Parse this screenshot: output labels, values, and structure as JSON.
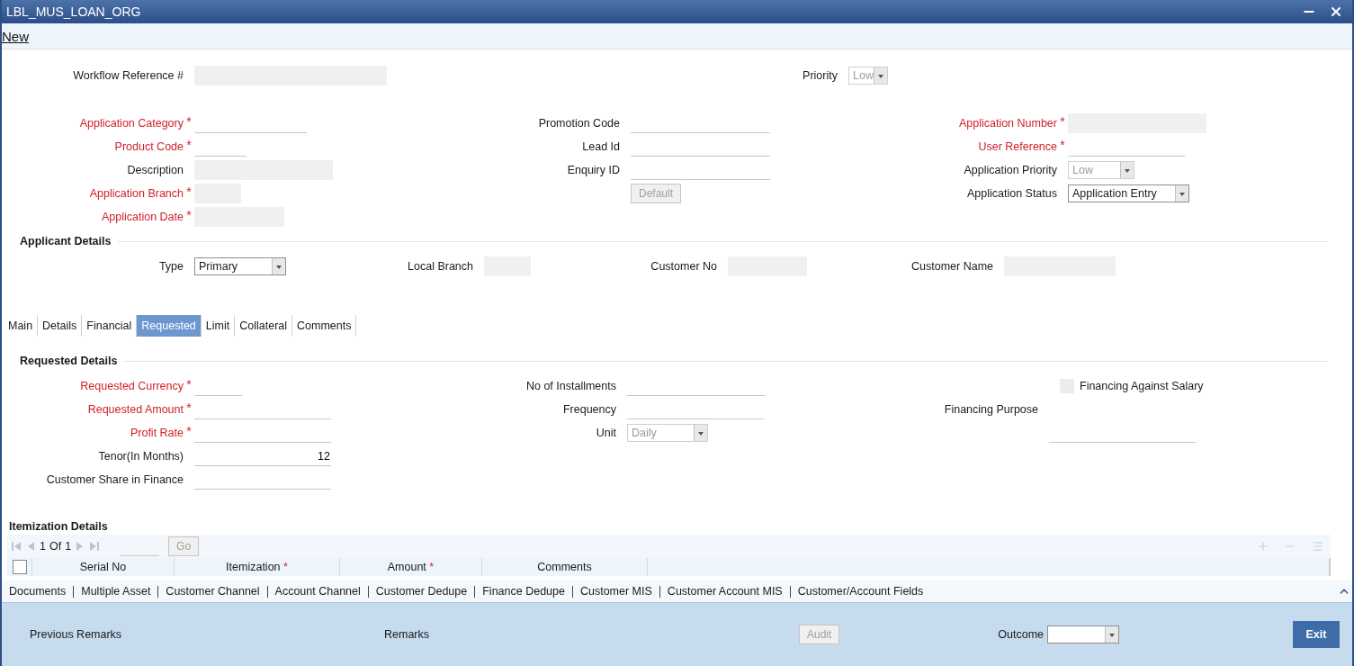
{
  "window": {
    "title": "LBL_MUS_LOAN_ORG"
  },
  "toolbar": {
    "link": "New"
  },
  "top_fields": [
    {
      "label": "Workflow Reference #",
      "kind": "text",
      "disabled": true
    },
    {
      "label": "Priority",
      "kind": "select",
      "value": "Low",
      "disabled": true
    }
  ],
  "header": {
    "columns": [
      [
        {
          "label": "Application Category",
          "required_mark": "*",
          "kind": "text",
          "disabled": false
        },
        {
          "label": "Product Code",
          "required_mark": "*",
          "kind": "text",
          "disabled": false
        },
        {
          "label": "Description",
          "kind": "text",
          "disabled": true
        },
        {
          "label": "Application Branch",
          "required_mark": "*",
          "kind": "text",
          "disabled": true
        },
        {
          "label": "Application Date",
          "required_mark": "*",
          "kind": "text",
          "disabled": true
        }
      ],
      [
        {
          "label": "Promotion Code",
          "kind": "text",
          "disabled": false
        },
        {
          "label": "Lead Id",
          "kind": "text",
          "disabled": false
        },
        {
          "label": "Enquiry ID",
          "kind": "text",
          "disabled": false
        },
        {
          "label": "Default",
          "kind": "button",
          "disabled": true
        }
      ],
      [
        {
          "label": "Application Number",
          "required_mark": "*",
          "kind": "text",
          "disabled": true
        },
        {
          "label": "User Reference",
          "required_mark": "*",
          "kind": "text",
          "disabled": false
        },
        {
          "label": "Application Priority",
          "kind": "select",
          "value": "Low",
          "disabled": true
        },
        {
          "label": "Application Status",
          "kind": "select",
          "value": "Application Entry",
          "disabled": false
        }
      ]
    ]
  },
  "applicant": {
    "title": "Applicant Details",
    "fields": [
      {
        "label": "Type",
        "kind": "select",
        "value": "Primary",
        "disabled": false
      },
      {
        "label": "Local Branch",
        "kind": "text",
        "disabled": true
      },
      {
        "label": "Customer No",
        "kind": "text",
        "disabled": true
      },
      {
        "label": "Customer Name",
        "kind": "text",
        "disabled": true
      }
    ]
  },
  "tabs": [
    {
      "label": "Main",
      "selected": false
    },
    {
      "label": "Details",
      "selected": false
    },
    {
      "label": "Financial",
      "selected": false
    },
    {
      "label": "Requested",
      "selected": true
    },
    {
      "label": "Limit",
      "selected": false
    },
    {
      "label": "Collateral",
      "selected": false
    },
    {
      "label": "Comments",
      "selected": false
    }
  ],
  "requested": {
    "title": "Requested Details",
    "columns": [
      [
        {
          "label": "Requested Currency",
          "required_mark": "*",
          "kind": "text",
          "disabled": false
        },
        {
          "label": "Requested Amount",
          "required_mark": "*",
          "kind": "text",
          "disabled": false
        },
        {
          "label": "Profit Rate",
          "required_mark": "*",
          "kind": "text",
          "disabled": false
        },
        {
          "label": "Tenor(In Months)",
          "kind": "number",
          "value": "12",
          "disabled": false
        },
        {
          "label": "Customer Share in Finance",
          "kind": "text",
          "disabled": false
        }
      ],
      [
        {
          "label": "No of Installments",
          "kind": "text",
          "disabled": false
        },
        {
          "label": "Frequency",
          "kind": "text",
          "disabled": false
        },
        {
          "label": "Unit",
          "kind": "select",
          "value": "Daily",
          "disabled": true
        }
      ],
      [
        {
          "label": "Financing Against Salary",
          "kind": "checkbox",
          "checked": false,
          "disabled": true
        },
        {
          "label": "Financing Purpose",
          "kind": "text_below",
          "disabled": false
        }
      ]
    ]
  },
  "itemization": {
    "title": "Itemization Details",
    "pager": {
      "current": "1",
      "of": "Of",
      "total": "1",
      "go": "Go",
      "go_disabled": true
    },
    "select_all_checked": false,
    "columns": [
      {
        "label": "Serial No"
      },
      {
        "label": "Itemization",
        "required_mark": "*"
      },
      {
        "label": "Amount",
        "required_mark": "*"
      },
      {
        "label": "Comments"
      }
    ]
  },
  "links": [
    "Documents",
    "Multiple Asset",
    "Customer Channel",
    "Account Channel",
    "Customer Dedupe",
    "Finance Dedupe",
    "Customer MIS",
    "Customer Account MIS",
    "Customer/Account Fields"
  ],
  "footer": {
    "previous_remarks": "Previous Remarks",
    "remarks": "Remarks",
    "audit": {
      "label": "Audit",
      "disabled": true
    },
    "outcome": {
      "label": "Outcome",
      "disabled": false
    },
    "exit": "Exit"
  }
}
